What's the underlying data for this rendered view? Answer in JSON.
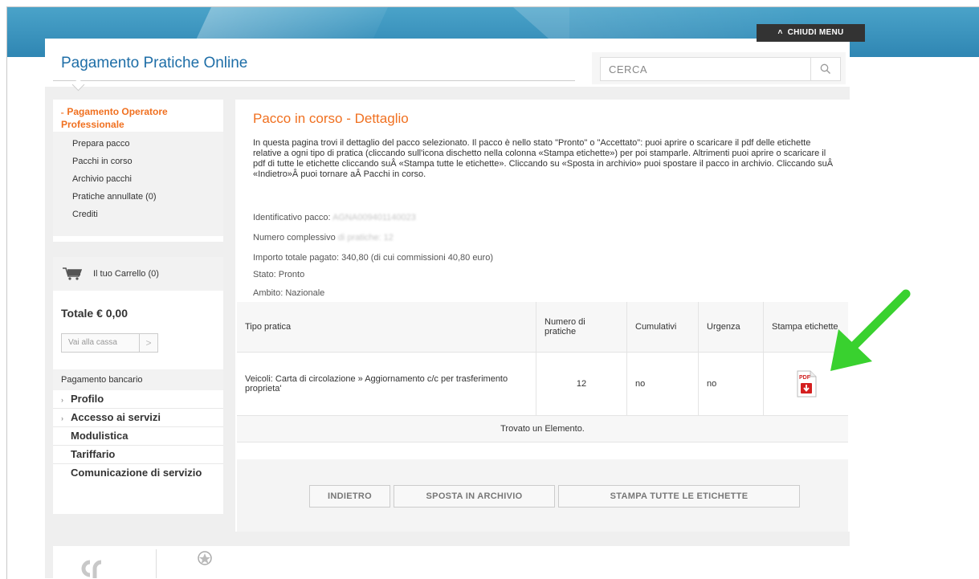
{
  "header": {
    "close_menu": "CHIUDI MENU",
    "site_title": "Pagamento Pratiche Online",
    "search_placeholder": "CERCA"
  },
  "sidebar": {
    "section_title": "Pagamento Operatore Professionale",
    "sub_items": [
      "Prepara pacco",
      "Pacchi in corso",
      "Archivio pacchi",
      "Pratiche annullate (0)",
      "Crediti"
    ],
    "cart_label": "Il tuo Carrello (0)",
    "cart_total": "Totale € 0,00",
    "checkout_label": "Vai alla cassa",
    "bank_label": "Pagamento bancario",
    "nav_items": [
      "Profilo",
      "Accesso ai servizi",
      "Modulistica",
      "Tariffario",
      "Comunicazione di servizio"
    ]
  },
  "main": {
    "title": "Pacco in corso - Dettaglio",
    "intro": "In questa pagina trovi il dettaglio del pacco selezionato. Il pacco è nello stato \"Pronto\" o \"Accettato\": puoi aprire o scaricare il pdf delle etichette relative a ogni tipo di pratica (cliccando sull'icona dischetto nella colonna «Stampa etichette») per poi stamparle. Altrimenti puoi aprire o scaricare il pdf di tutte le etichette cliccando suÂ «Stampa tutte le etichette». Cliccando su «Sposta in archivio» puoi spostare il pacco in archivio. Cliccando suÂ «Indietro»Â puoi tornare aÂ Pacchi in corso.",
    "id_label": "Identificativo pacco:",
    "id_value": "AGNA009401140023",
    "count_label": "Numero complessivo",
    "count_value": "di pratiche: 12",
    "amount": "Importo totale pagato: 340,80  (di cui commissioni 40,80 euro)",
    "state": "Stato: Pronto",
    "scope": "Ambito: Nazionale"
  },
  "table": {
    "headers": [
      "Tipo pratica",
      "Numero di pratiche",
      "Cumulativi",
      "Urgenza",
      "Stampa etichette"
    ],
    "row": {
      "tipo": "Veicoli: Carta di circolazione » Aggiornamento c/c per trasferimento proprieta'",
      "numero": "12",
      "cumulativi": "no",
      "urgenza": "no"
    },
    "found": "Trovato un Elemento."
  },
  "buttons": {
    "back": "INDIETRO",
    "archive": "SPOSTA IN ARCHIVIO",
    "print_all": "STAMPA TUTTE LE ETICHETTE"
  },
  "icons": [
    "search-icon",
    "cart-icon",
    "pdf-download-icon",
    "green-arrow",
    "chevron-up-icon"
  ],
  "colors": {
    "accent": "#f07020",
    "title_blue": "#1e6ea7",
    "banner": "#3a94c0",
    "arrow": "#39d12f"
  }
}
